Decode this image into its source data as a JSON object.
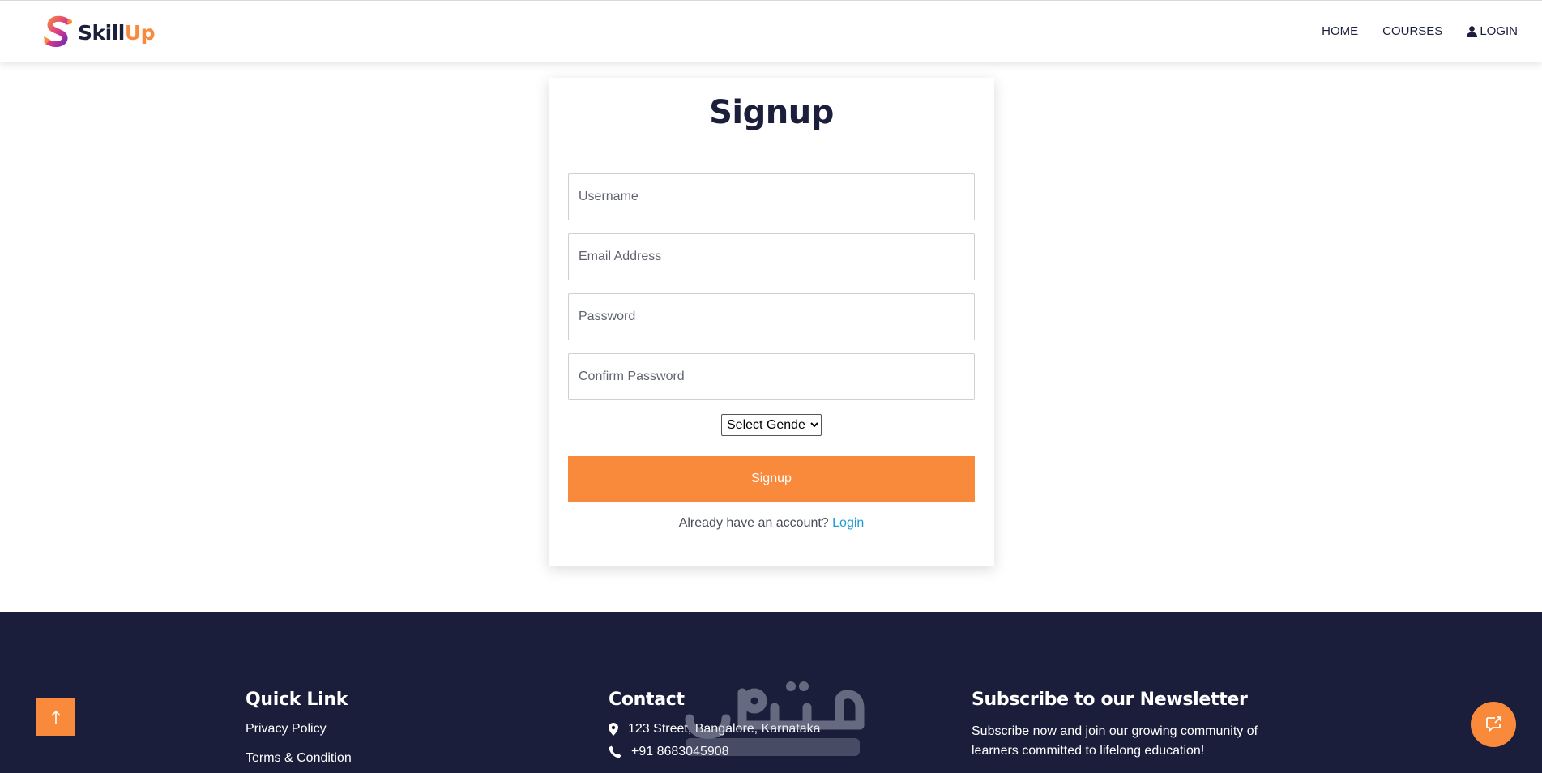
{
  "brand": {
    "name_part1": "Skill",
    "name_part2": "Up",
    "accent": "#f98a3b",
    "dark": "#1b1f3b"
  },
  "nav": {
    "home": "HOME",
    "courses": "COURSES",
    "login": "LOGIN"
  },
  "signup": {
    "title": "Signup",
    "username_placeholder": "Username",
    "email_placeholder": "Email Address",
    "password_placeholder": "Password",
    "confirm_placeholder": "Confirm Password",
    "gender_selected": "Select Gender",
    "button_label": "Signup",
    "already_text": "Already have an account?",
    "login_link": "Login"
  },
  "footer": {
    "background": "#1a1e3a",
    "quick_link_title": "Quick Link",
    "links": [
      "Privacy Policy",
      "Terms & Condition"
    ],
    "contact_title": "Contact",
    "address": "123 Street, Bangalore, Karnataka",
    "phone": "+91 8683045908",
    "newsletter_title": "Subscribe to our Newsletter",
    "newsletter_text": "Subscribe now and join our growing community of learners committed to lifelong education!"
  },
  "icons": {
    "scroll_top": "arrow-up-icon",
    "chat": "chat-icon",
    "user": "user-icon",
    "location": "map-pin-icon",
    "phone": "phone-icon"
  }
}
